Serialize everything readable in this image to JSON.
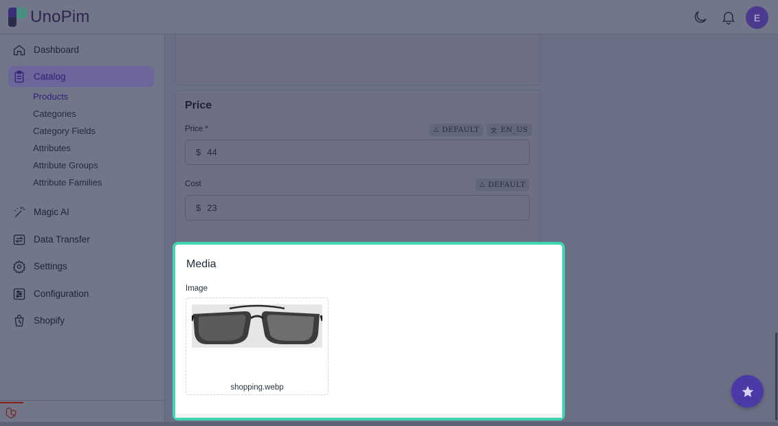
{
  "app": {
    "name": "UnoPim",
    "user_initial": "E"
  },
  "sidebar": {
    "items": [
      {
        "label": "Dashboard",
        "icon": "home-icon"
      },
      {
        "label": "Catalog",
        "icon": "clipboard-icon",
        "active": true
      },
      {
        "label": "Magic AI",
        "icon": "magic-wand-icon"
      },
      {
        "label": "Data Transfer",
        "icon": "transfer-icon"
      },
      {
        "label": "Settings",
        "icon": "gear-icon"
      },
      {
        "label": "Configuration",
        "icon": "sliders-icon"
      },
      {
        "label": "Shopify",
        "icon": "shopify-bag-icon"
      }
    ],
    "catalog_sub": [
      "Products",
      "Categories",
      "Category Fields",
      "Attributes",
      "Attribute Groups",
      "Attribute Families"
    ]
  },
  "price_section": {
    "title": "Price",
    "price": {
      "label": "Price *",
      "currency": "$",
      "value": "44",
      "chips": [
        "DEFAULT",
        "EN_US"
      ]
    },
    "cost": {
      "label": "Cost",
      "currency": "$",
      "value": "23",
      "chips": [
        "DEFAULT"
      ]
    }
  },
  "media_section": {
    "title": "Media",
    "image_label": "Image",
    "file_name": "shopping.webp"
  },
  "colors": {
    "accent": "#4a3aa8",
    "highlight": "#3ed6b0"
  }
}
